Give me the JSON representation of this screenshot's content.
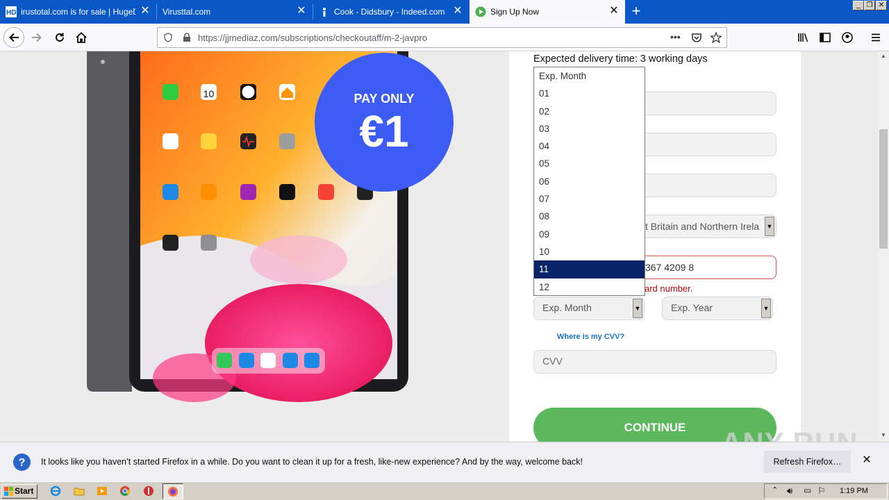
{
  "tabs": [
    {
      "title": "irustotal.com is for sale | HugeDom",
      "favicon": "hd-icon"
    },
    {
      "title": "Virusttal.com",
      "favicon": ""
    },
    {
      "title": "Cook - Didsbury - Indeed.com",
      "favicon": "indeed-icon"
    },
    {
      "title": "Sign Up Now",
      "favicon": "play-icon"
    }
  ],
  "navbar": {
    "url": "https://jjmediaz.com/subscriptions/checkoutaff/m-2-javpro",
    "more": "•••"
  },
  "promo": {
    "line1": "PAY ONLY",
    "line2": "€1"
  },
  "ipad": {
    "apps_row1": [
      "FaceTime",
      "Calendar",
      "Clock",
      "Home"
    ],
    "calendar_day": "10"
  },
  "form": {
    "delivery": "Expected delivery time: 3 working days",
    "country_partial": "t Britain and Northern Irela",
    "card_partial": "367 4209 8",
    "error_partial": "ard number.",
    "exp_month": "Exp. Month",
    "exp_year": "Exp. Year",
    "cvv_link": "Where is my CVV?",
    "cvv_placeholder": "CVV",
    "continue": "CONTINUE"
  },
  "month_dropdown": {
    "options": [
      "Exp. Month",
      "01",
      "02",
      "03",
      "04",
      "05",
      "06",
      "07",
      "08",
      "09",
      "10",
      "11",
      "12"
    ],
    "selected": "11"
  },
  "notification": {
    "message": "It looks like you haven’t started Firefox in a while. Do you want to clean it up for a fresh, like-new experience? And by the way, welcome back!",
    "button": "Refresh Firefox…"
  },
  "watermark": "ANY RUN",
  "taskbar": {
    "start": "Start",
    "time": "1:19 PM"
  },
  "colors": {
    "tabbar": "#0a58c8",
    "promo_circle": "#3d5cf5",
    "continue_button": "#5cb85c",
    "error": "#c00000",
    "dropdown_selected": "#0a246a"
  }
}
